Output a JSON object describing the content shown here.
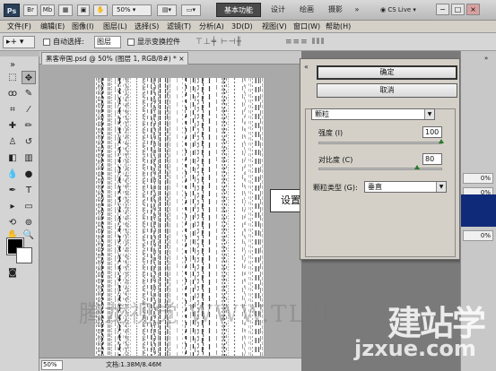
{
  "app": {
    "logo": "Ps",
    "bridge_btn": "Br",
    "mini_bridge_btn": "Mb",
    "zoom_level": "50%",
    "workspaces": [
      "基本功能",
      "设计",
      "绘画",
      "摄影"
    ],
    "workspace_more": "»",
    "cs_live": "CS Live",
    "window_controls": [
      "−",
      "□",
      "×"
    ]
  },
  "menu": [
    "文件(F)",
    "编辑(E)",
    "图像(I)",
    "图层(L)",
    "选择(S)",
    "滤镜(T)",
    "分析(A)",
    "3D(D)",
    "视图(V)",
    "窗口(W)",
    "帮助(H)"
  ],
  "options": {
    "tool_preset": "▸+",
    "auto_select_label": "自动选择:",
    "auto_select_value": "图层",
    "show_transform_label": "显示变换控件"
  },
  "document": {
    "tab_title": "黑客帝国.psd @ 50% (图层 1, RGB/8#) *",
    "tab_close": "×",
    "zoom": "50%",
    "doc_info": "文档:1.38M/8.46M"
  },
  "callout": "设置",
  "dialog": {
    "collapse": "«",
    "ok_label": "确定",
    "cancel_label": "取消",
    "filter": "颗粒",
    "intensity_label": "强度 (I)",
    "intensity_value": "100",
    "intensity_level": 1.0,
    "contrast_label": "对比度 (C)",
    "contrast_value": "80",
    "contrast_level": 0.8,
    "grain_type_label": "颗粒类型 (G):",
    "grain_type_value": "垂直"
  },
  "right_panel": {
    "collapse": "»",
    "values": [
      "0%",
      "0%",
      "0%"
    ]
  },
  "watermarks": {
    "center": "腾龙视觉 WWW.TLVI",
    "site_big": "建站学",
    "site_url": "jzxue.com"
  }
}
